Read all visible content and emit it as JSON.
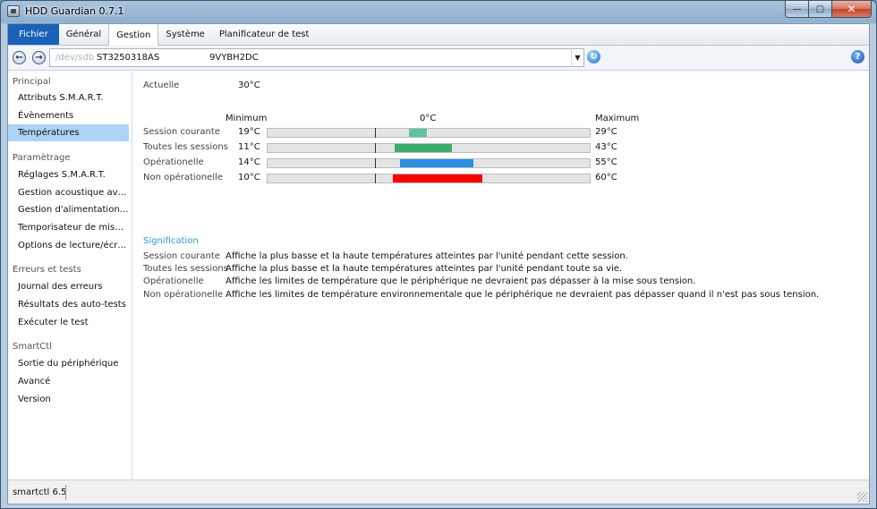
{
  "window": {
    "title": "HDD Guardian 0.7.1"
  },
  "titlebar_buttons": {
    "minimize": "—",
    "maximize": "▢",
    "close": "✕"
  },
  "menubar": [
    "Fichier",
    "Général",
    "Gestion",
    "Système",
    "Planificateur de test"
  ],
  "toolbar": {
    "back": "←",
    "forward": "→",
    "device_path": "/dev/sdb",
    "device_model": "ST3250318AS",
    "device_serial": "9VYBH2DC",
    "dropdown": "▼",
    "refresh": "↻",
    "help": "?"
  },
  "sidebar": {
    "sections": [
      {
        "title": "Principal",
        "items": [
          "Attributs S.M.A.R.T.",
          "Évènements",
          "Températures"
        ]
      },
      {
        "title": "Paramètrage",
        "items": [
          "Réglages S.M.A.R.T.",
          "Gestion acoustique avancée",
          "Gestion d'alimentation avancée",
          "Temporisateur de mise en veille",
          "Options de lecture/écriture"
        ]
      },
      {
        "title": "Erreurs et tests",
        "items": [
          "Journal des erreurs",
          "Résultats des auto-tests",
          "Exécuter le test"
        ]
      },
      {
        "title": "SmartCtl",
        "items": [
          "Sortie du périphérique",
          "Avancé",
          "Version"
        ]
      }
    ],
    "active_item": "Températures"
  },
  "temperatures": {
    "current_label": "Actuelle",
    "current_value": "30°C",
    "header_min": "Minimum",
    "header_zero": "0°C",
    "header_max": "Maximum",
    "rows": [
      {
        "label": "Session courante",
        "min": "19°C",
        "max": "29°C",
        "min_c": 19,
        "max_c": 29,
        "color": "#5fc4a4"
      },
      {
        "label": "Toutes les sessions",
        "min": "11°C",
        "max": "43°C",
        "min_c": 11,
        "max_c": 43,
        "color": "#3cab6c"
      },
      {
        "label": "Opérationelle",
        "min": "14°C",
        "max": "55°C",
        "min_c": 14,
        "max_c": 55,
        "color": "#2a8fe5"
      },
      {
        "label": "Non opérationelle",
        "min": "10°C",
        "max": "60°C",
        "min_c": 10,
        "max_c": 60,
        "color": "#ff0000"
      }
    ],
    "scale_min_c": -60,
    "scale_max_c": 120
  },
  "signification": {
    "title": "Signification",
    "rows": [
      {
        "term": "Session courante",
        "text": "Affiche la plus basse et la haute températures atteintes par l'unité pendant cette session."
      },
      {
        "term": "Toutes les sessions",
        "text": "Affiche la plus basse et la haute températures atteintes par l'unité pendant toute sa vie."
      },
      {
        "term": "Opérationelle",
        "text": "Affiche les limites de température que le périphérique ne devraient pas dépasser à la mise sous tension."
      },
      {
        "term": "Non opérationelle",
        "text": "Affiche les limites de température environnementale que le périphérique ne devraient pas dépasser quand il n'est pas sous tension."
      }
    ]
  },
  "statusbar": {
    "text": "smartctl 6.5"
  }
}
